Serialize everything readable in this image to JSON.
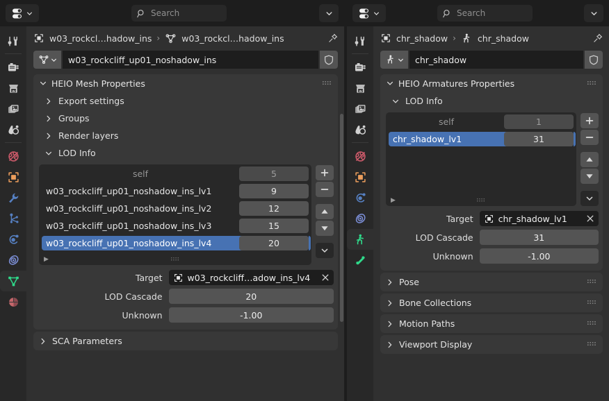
{
  "left_editor": {
    "topbar": {
      "editor_type_icon": "properties-editor-icon",
      "search_placeholder": "Search",
      "search_value": "",
      "options_icon": "chevron-down-icon"
    },
    "tabs": [
      {
        "name": "tool",
        "icon": "tool-icon",
        "active": false
      },
      {
        "name": "render",
        "icon": "render-camera-icon",
        "active": false
      },
      {
        "name": "output",
        "icon": "output-printer-icon",
        "active": false
      },
      {
        "name": "view-layer",
        "icon": "view-layer-images-icon",
        "active": false
      },
      {
        "name": "scene",
        "icon": "scene-cone-droplet-icon",
        "active": false
      },
      {
        "name": "world",
        "icon": "world-globe-icon",
        "active": false
      },
      {
        "name": "object",
        "icon": "object-square-icon",
        "active": false
      },
      {
        "name": "modifiers",
        "icon": "wrench-icon",
        "active": false
      },
      {
        "name": "particles",
        "icon": "particles-icon",
        "active": false
      },
      {
        "name": "physics",
        "icon": "physics-orbit-icon",
        "active": false
      },
      {
        "name": "object-constraints",
        "icon": "constraint-icon",
        "active": false
      },
      {
        "name": "object-data-mesh",
        "icon": "mesh-data-triangle-icon",
        "active": true
      },
      {
        "name": "material",
        "icon": "material-sphere-icon",
        "active": false
      }
    ],
    "breadcrumb": {
      "object_icon": "object-square-icon",
      "object_name": "w03_rockcl…hadow_ins",
      "separator": "›",
      "data_icon": "mesh-data-triangle-icon",
      "data_name": "w03_rockcl…hadow_ins",
      "pin_icon": "pin-icon"
    },
    "id_row": {
      "type_icon": "mesh-data-triangle-icon",
      "dropdown_icon": "chevron-down-icon",
      "name": "w03_rockcliff_up01_noshadow_ins",
      "shield_icon": "shield-fake-user-icon"
    },
    "panel": {
      "title": "HEIO Mesh Properties",
      "expand_icon": "chevron-down-icon",
      "grip_icon": "grip-dots-icon",
      "subpanels": [
        {
          "label": "Export settings",
          "icon": "chevron-right-icon",
          "open": false
        },
        {
          "label": "Groups",
          "icon": "chevron-right-icon",
          "open": false
        },
        {
          "label": "Render layers",
          "icon": "chevron-right-icon",
          "open": false
        },
        {
          "label": "LOD Info",
          "icon": "chevron-down-icon",
          "open": true
        }
      ]
    },
    "lod_list": {
      "rows": [
        {
          "name": "self",
          "value": "5",
          "muted": true,
          "selected": false
        },
        {
          "name": "w03_rockcliff_up01_noshadow_ins_lv1",
          "value": "9",
          "muted": false,
          "selected": false
        },
        {
          "name": "w03_rockcliff_up01_noshadow_ins_lv2",
          "value": "12",
          "muted": false,
          "selected": false
        },
        {
          "name": "w03_rockcliff_up01_noshadow_ins_lv3",
          "value": "15",
          "muted": false,
          "selected": false
        },
        {
          "name": "w03_rockcliff_up01_noshadow_ins_lv4",
          "value": "20",
          "muted": false,
          "selected": true
        }
      ],
      "footer_icon": "triangle-right-icon",
      "footer_grip_icon": "grip-dots-icon",
      "buttons": [
        {
          "name": "add-lod-button",
          "icon": "plus-icon"
        },
        {
          "name": "remove-lod-button",
          "icon": "minus-icon"
        },
        {
          "name": "move-lod-up-button",
          "icon": "triangle-up-icon"
        },
        {
          "name": "move-lod-down-button",
          "icon": "triangle-down-icon"
        },
        {
          "name": "lod-specials-menu-button",
          "icon": "chevron-down-icon"
        }
      ]
    },
    "fields": [
      {
        "label": "Target",
        "value": "w03_rockcliff…adow_ins_lv4",
        "kind": "idref",
        "icon": "object-square-icon",
        "clear_icon": "x-icon"
      },
      {
        "label": "LOD Cascade",
        "value": "20",
        "kind": "number"
      },
      {
        "label": "Unknown",
        "value": "-1.00",
        "kind": "number"
      }
    ],
    "collapsed_panels": [
      {
        "label": "SCA Parameters",
        "icon": "chevron-right-icon",
        "grip": "grip-dots-icon"
      }
    ]
  },
  "right_editor": {
    "topbar": {
      "editor_type_icon": "properties-editor-icon",
      "search_placeholder": "Search",
      "search_value": "",
      "options_icon": "chevron-down-icon"
    },
    "tabs": [
      {
        "name": "tool",
        "icon": "tool-icon",
        "active": false
      },
      {
        "name": "render",
        "icon": "render-camera-icon",
        "active": false
      },
      {
        "name": "output",
        "icon": "output-printer-icon",
        "active": false
      },
      {
        "name": "view-layer",
        "icon": "view-layer-images-icon",
        "active": false
      },
      {
        "name": "scene",
        "icon": "scene-cone-droplet-icon",
        "active": false
      },
      {
        "name": "world",
        "icon": "world-globe-icon",
        "active": false
      },
      {
        "name": "object",
        "icon": "object-square-icon",
        "active": false
      },
      {
        "name": "physics",
        "icon": "physics-orbit-icon",
        "active": false
      },
      {
        "name": "object-constraints",
        "icon": "constraint-icon",
        "active": false
      },
      {
        "name": "object-data-armature",
        "icon": "armature-data-icon",
        "active": true
      },
      {
        "name": "bone",
        "icon": "bone-icon",
        "active": false
      }
    ],
    "breadcrumb": {
      "object_icon": "object-square-icon",
      "object_name": "chr_shadow",
      "separator": "›",
      "data_icon": "armature-data-icon",
      "data_name": "chr_shadow",
      "pin_icon": "pin-icon"
    },
    "id_row": {
      "type_icon": "armature-data-icon",
      "dropdown_icon": "chevron-down-icon",
      "name": "chr_shadow",
      "shield_icon": "shield-fake-user-icon"
    },
    "panel": {
      "title": "HEIO Armatures Properties",
      "expand_icon": "chevron-down-icon",
      "grip_icon": "grip-dots-icon",
      "subpanels": [
        {
          "label": "LOD Info",
          "icon": "chevron-down-icon",
          "open": true
        }
      ]
    },
    "lod_list": {
      "rows": [
        {
          "name": "self",
          "value": "1",
          "muted": true,
          "selected": false
        },
        {
          "name": "chr_shadow_lv1",
          "value": "31",
          "muted": false,
          "selected": true
        }
      ],
      "footer_icon": "triangle-right-icon",
      "footer_grip_icon": "grip-dots-icon",
      "buttons": [
        {
          "name": "add-lod-button",
          "icon": "plus-icon"
        },
        {
          "name": "remove-lod-button",
          "icon": "minus-icon"
        },
        {
          "name": "move-lod-up-button",
          "icon": "triangle-up-icon"
        },
        {
          "name": "move-lod-down-button",
          "icon": "triangle-down-icon"
        },
        {
          "name": "lod-specials-menu-button",
          "icon": "chevron-down-icon"
        }
      ]
    },
    "fields": [
      {
        "label": "Target",
        "value": "chr_shadow_lv1",
        "kind": "idref",
        "icon": "object-square-icon",
        "clear_icon": "x-icon"
      },
      {
        "label": "LOD Cascade",
        "value": "31",
        "kind": "number"
      },
      {
        "label": "Unknown",
        "value": "-1.00",
        "kind": "number"
      }
    ],
    "collapsed_panels": [
      {
        "label": "Pose",
        "icon": "chevron-right-icon",
        "grip": "grip-dots-icon"
      },
      {
        "label": "Bone Collections",
        "icon": "chevron-right-icon",
        "grip": "grip-dots-icon"
      },
      {
        "label": "Motion Paths",
        "icon": "chevron-right-icon",
        "grip": "grip-dots-icon"
      },
      {
        "label": "Viewport Display",
        "icon": "chevron-right-icon",
        "grip": "grip-dots-icon"
      }
    ]
  },
  "colors": {
    "window_bg": "#1d1d1d",
    "editor_bg": "#303030",
    "panel_bg": "#383838",
    "tabrail_bg": "#282828",
    "field_bg": "#545454",
    "select_blue": "#4772b3",
    "text": "#e5e5e5",
    "text_muted": "#959595",
    "icon_object_orange": "#ed9e5c",
    "icon_mesh_green": "#2fd98a",
    "icon_modifier_blue": "#5680c2",
    "icon_world_red": "#cc5a6a",
    "icon_material_red": "#c4676b"
  }
}
